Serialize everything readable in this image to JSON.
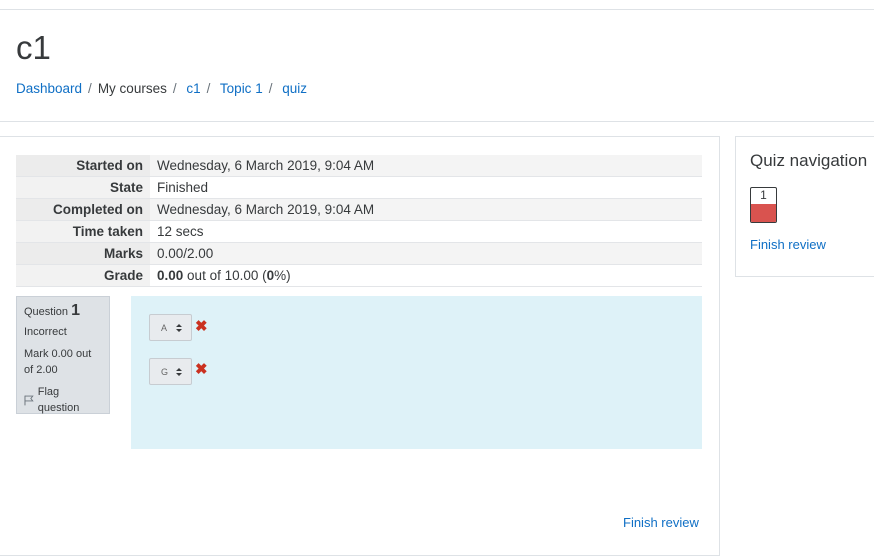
{
  "header": {
    "title": "c1",
    "breadcrumb": [
      "Dashboard",
      "My courses",
      "c1",
      "Topic 1",
      "quiz"
    ]
  },
  "summary": {
    "rows": [
      {
        "label": "Started on",
        "value": "Wednesday, 6 March 2019, 9:04 AM"
      },
      {
        "label": "State",
        "value": "Finished"
      },
      {
        "label": "Completed on",
        "value": "Wednesday, 6 March 2019, 9:04 AM"
      },
      {
        "label": "Time taken",
        "value": "12 secs"
      },
      {
        "label": "Marks",
        "value": "0.00/2.00"
      }
    ],
    "grade": {
      "label": "Grade",
      "score": "0.00",
      "mid": "out of 10.00 (",
      "pct": "0",
      "end": "%)"
    }
  },
  "question": {
    "label": "Question",
    "number": "1",
    "state": "Incorrect",
    "mark": "Mark 0.00 out of 2.00",
    "flag": "Flag question",
    "flag_icon": "flag-icon",
    "answers": [
      {
        "value": "A",
        "result_icon": "cross-icon"
      },
      {
        "value": "G",
        "result_icon": "cross-icon"
      }
    ]
  },
  "nav": {
    "title": "Quiz navigation",
    "question_button": "1",
    "finish_review": "Finish review"
  },
  "main_finish_review": "Finish review",
  "colors": {
    "link": "#0f6fc5",
    "incorrect": "#ca3120",
    "question_bg": "#def2f8",
    "nav_incorrect": "#d9534f"
  }
}
